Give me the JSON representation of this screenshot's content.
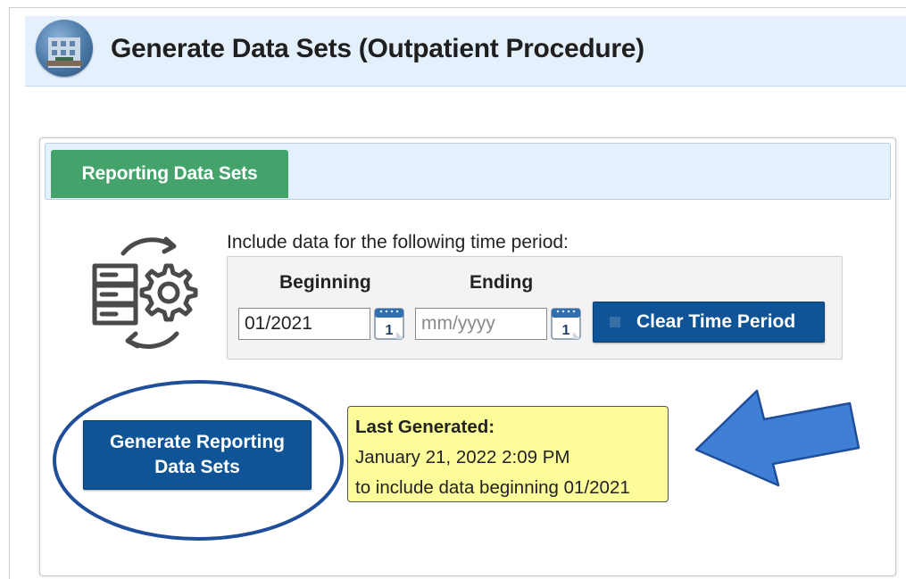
{
  "header": {
    "title": "Generate Data Sets (Outpatient Procedure)",
    "avatar_icon": "building-photo-icon"
  },
  "tabs": [
    {
      "label": "Reporting Data Sets",
      "active": true,
      "color": "#44a36b"
    }
  ],
  "time_period": {
    "instruction": "Include data for the following time period:",
    "beginning_label": "Beginning",
    "ending_label": "Ending",
    "beginning_value": "01/2021",
    "ending_value": "",
    "ending_placeholder": "mm/yyyy",
    "calendar_icon": "calendar-icon",
    "calendar_day": "1",
    "clear_button_label": "Clear Time Period"
  },
  "generate": {
    "button_label_line1": "Generate Reporting",
    "button_label_line2": "Data Sets"
  },
  "last_generated": {
    "title": "Last Generated:",
    "timestamp": "January 21, 2022 2:09 PM",
    "note": "to include data beginning 01/2021",
    "background": "#fcfc9a"
  },
  "annotations": {
    "ellipse_color": "#1f4f9a",
    "arrow_color": "#3f7fd6"
  },
  "colors": {
    "primary_button": "#0f5496",
    "header_bg": "#e4f0fb"
  }
}
